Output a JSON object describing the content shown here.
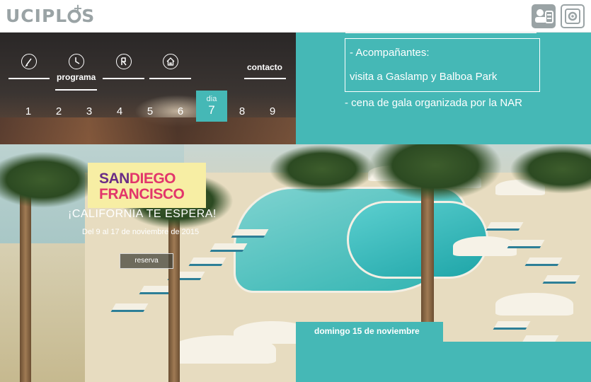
{
  "header": {
    "logo_text": "UCIPL",
    "logo_text_end": "S",
    "logo_plus": "+",
    "icons": [
      "user-card-icon",
      "settings-gear-icon"
    ]
  },
  "nav": {
    "items": [
      {
        "icon": "pen-icon",
        "label": ""
      },
      {
        "icon": "clock-icon",
        "label": "programa"
      },
      {
        "icon": "restaurant-icon",
        "label": ""
      },
      {
        "icon": "house-icon",
        "label": ""
      }
    ],
    "contact_label": "contacto",
    "day_word": "dia",
    "days": [
      "1",
      "2",
      "3",
      "4",
      "5",
      "6",
      "7",
      "8",
      "9"
    ],
    "selected_day": "7"
  },
  "info": {
    "line1": "- Acompañantes:",
    "line2": "visita a Gaslamp y Balboa Park",
    "line3": "- cena de gala organizada por la NAR"
  },
  "promo": {
    "word1": "SAN",
    "word2": "DIEGO",
    "word3": "FRANCISCO",
    "tagline": "¡CALIFORNIA TE ESPERA!",
    "dates": "Del 9 al 17 de noviembre de 2015",
    "reserve_label": "reserva"
  },
  "schedule": {
    "date_label": "domingo 15 de noviembre"
  },
  "colors": {
    "teal": "#45b8b6",
    "logo_gray": "#9aa3a5",
    "promo_yellow": "#f7eea4",
    "promo_purple": "#6a2c86",
    "promo_pink": "#e2356b"
  }
}
